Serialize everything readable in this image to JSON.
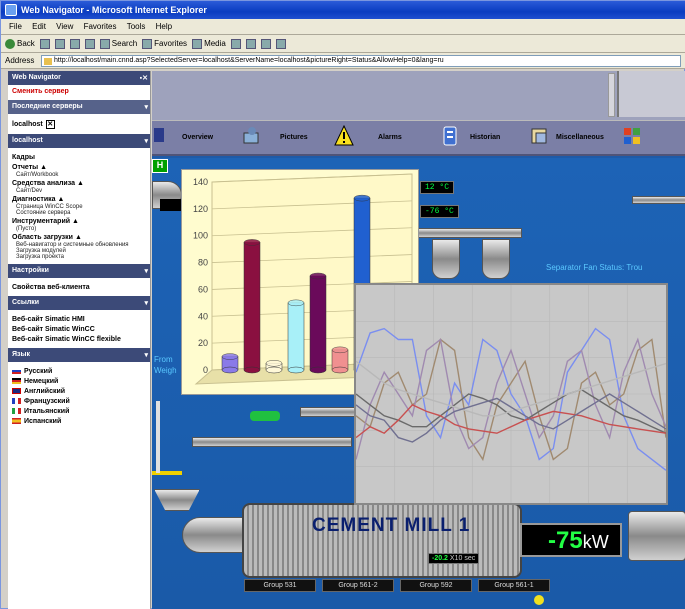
{
  "window": {
    "title": "Web Navigator - Microsoft Internet Explorer"
  },
  "menu": [
    "File",
    "Edit",
    "View",
    "Favorites",
    "Tools",
    "Help"
  ],
  "toolbar": {
    "back": "Back",
    "search": "Search",
    "favorites": "Favorites",
    "media": "Media"
  },
  "address": {
    "label": "Address",
    "url": "http://localhost/main.cnnd.asp?SelectedServer=localhost&ServerName=localhost&pictureRight=Status&AllowHelp=0&lang=ru"
  },
  "sidebar": {
    "header1": "Web Navigator",
    "link_change": "Сменить сервер",
    "header2": "Последние серверы",
    "server": "localhost",
    "header3": "localhost",
    "kadry": "Кадры",
    "otchety": "Отчеты",
    "otchety_sub": "Сайт/Workbook",
    "sredstva": "Средства анализа",
    "sredstva_sub": "Сайт/Dev",
    "diagnostika": "Диагностика",
    "diag_sub1": "Страница WinCC Scope",
    "diag_sub2": "Состояние сервера",
    "instr": "Инструментарий",
    "instr_sub": "(Пусто)",
    "zagruzka": "Область загрузки",
    "zag_sub1": "Веб-навигатор и системные обновления",
    "zag_sub2": "Загрузка модулей",
    "zag_sub3": "Загрузка проекта",
    "header4": "Настройки",
    "settings": "Свойства веб-клиента",
    "header5": "Ссылки",
    "link1": "Веб-сайт Simatic HMI",
    "link2": "Веб-сайт Simatic WinCC",
    "link3": "Веб-сайт Simatic WinCC flexible",
    "header6": "Язык",
    "languages": [
      "Русский",
      "Немецкий",
      "Английский",
      "Французский",
      "Итальянский",
      "Испанский"
    ]
  },
  "nav": {
    "overview": "Overview",
    "pictures": "Pictures",
    "alarms": "Alarms",
    "historian": "Historian",
    "misc": "Miscellaneous"
  },
  "plant": {
    "temp1": "12 °C",
    "temp2": "-76 °C",
    "h_label": "H",
    "separator": "Separator Fan Status: Trou",
    "from_text1": "From",
    "from_text2": "Weigh",
    "mill_title": "CEMENT MILL 1",
    "kw_value": "-75",
    "kw_unit": "kW",
    "small_value": "-20.2",
    "small_unit": "X10 sec",
    "groups": [
      "Group 531",
      "Group 561-2",
      "Group 592",
      "Group 561-1"
    ]
  },
  "colors": {
    "plant_bg": "#1e5aa8",
    "display_green": "#22ff44",
    "mill_text": "#0a1f6e"
  },
  "chart_data": [
    {
      "type": "bar",
      "yticks": [
        "0",
        "20",
        "40",
        "60",
        "80",
        "100",
        "120",
        "140"
      ],
      "ylim": [
        0,
        140
      ],
      "values": [
        10,
        95,
        5,
        50,
        70,
        15,
        128
      ],
      "colors": [
        "#8a7ae8",
        "#8a1040",
        "#fff8d8",
        "#a8f0f8",
        "#6a0a5a",
        "#f09090",
        "#2060d0"
      ]
    },
    {
      "type": "line",
      "series": [
        {
          "color": "#7a8ef0",
          "values": [
            60,
            78,
            80,
            75,
            75,
            40,
            30,
            55,
            45,
            75,
            70,
            50,
            40,
            20,
            25,
            60,
            70,
            80,
            75,
            40,
            25,
            20,
            15
          ]
        },
        {
          "color": "#a08a70",
          "values": [
            40,
            35,
            55,
            60,
            45,
            50,
            75,
            70,
            30,
            20,
            45,
            55,
            65,
            40,
            20,
            25,
            55,
            60,
            45,
            50,
            70,
            75,
            30
          ]
        },
        {
          "color": "#a08ab0",
          "values": [
            20,
            45,
            60,
            50,
            40,
            70,
            75,
            40,
            25,
            30,
            55,
            70,
            50,
            30,
            40,
            65,
            70,
            45,
            30,
            60,
            75,
            50,
            35
          ]
        },
        {
          "color": "#6a6a6a",
          "values": [
            50,
            45,
            40,
            38,
            35,
            35,
            40,
            45,
            50,
            48,
            45,
            40,
            38,
            42,
            46,
            50,
            52,
            48,
            44,
            40,
            38,
            35,
            32
          ]
        },
        {
          "color": "#b8b8b8",
          "values": [
            65,
            60,
            55,
            52,
            50,
            48,
            46,
            44,
            42,
            40,
            40,
            42,
            44,
            46,
            48,
            50,
            52,
            54,
            56,
            58,
            60,
            62,
            64
          ]
        },
        {
          "color": "#c85050",
          "values": [
            30,
            35,
            32,
            38,
            45,
            42,
            40,
            36,
            34,
            33,
            32,
            35,
            38,
            40,
            42,
            41,
            40,
            38,
            36,
            35,
            34,
            33,
            32
          ]
        },
        {
          "color": "#707090",
          "values": [
            45,
            40,
            38,
            30,
            28,
            32,
            38,
            42,
            44,
            46,
            48,
            44,
            40,
            36,
            34,
            38,
            42,
            46,
            50,
            46,
            42,
            38,
            34
          ]
        }
      ]
    }
  ]
}
